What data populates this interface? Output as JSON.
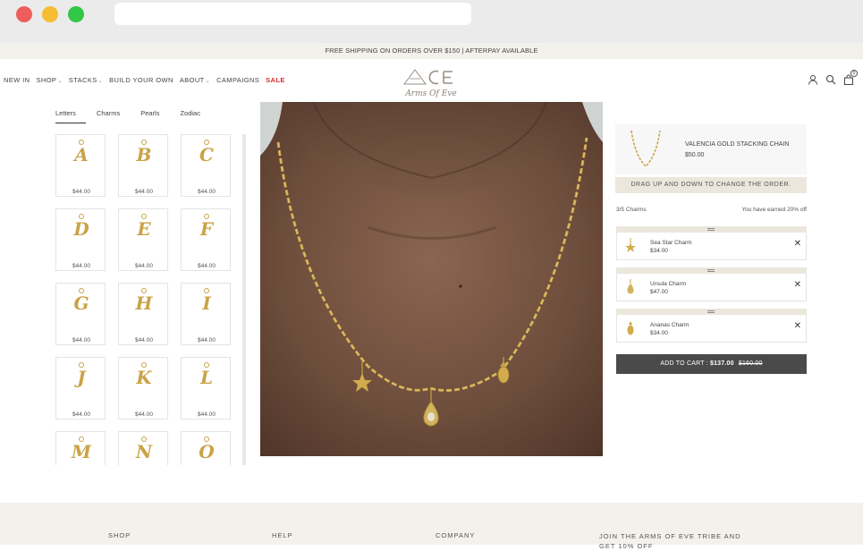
{
  "announcement": "FREE SHIPPING ON ORDERS OVER $150 | AFTERPAY AVAILABLE",
  "nav": {
    "links": [
      {
        "label": "NEW IN",
        "has_caret": false
      },
      {
        "label": "SHOP",
        "has_caret": true
      },
      {
        "label": "STACKS",
        "has_caret": true
      },
      {
        "label": "BUILD YOUR OWN",
        "has_caret": false
      },
      {
        "label": "ABOUT",
        "has_caret": true
      },
      {
        "label": "CAMPAIGNS",
        "has_caret": false
      }
    ],
    "sale_label": "SALE",
    "logo_text": "Arms Of Eve",
    "cart_count": "0"
  },
  "tabs": [
    "Letters",
    "Charms",
    "Pearls",
    "Zodiac"
  ],
  "products": [
    {
      "letter": "A",
      "price": "$44.00"
    },
    {
      "letter": "B",
      "price": "$44.00"
    },
    {
      "letter": "C",
      "price": "$44.00"
    },
    {
      "letter": "D",
      "price": "$44.00"
    },
    {
      "letter": "E",
      "price": "$44.00"
    },
    {
      "letter": "F",
      "price": "$44.00"
    },
    {
      "letter": "G",
      "price": "$44.00"
    },
    {
      "letter": "H",
      "price": "$44.00"
    },
    {
      "letter": "I",
      "price": "$44.00"
    },
    {
      "letter": "J",
      "price": "$44.00"
    },
    {
      "letter": "K",
      "price": "$44.00"
    },
    {
      "letter": "L",
      "price": "$44.00"
    },
    {
      "letter": "M",
      "price": ""
    },
    {
      "letter": "N",
      "price": ""
    },
    {
      "letter": "O",
      "price": ""
    }
  ],
  "chain": {
    "name": "VALENCIA GOLD STACKING CHAIN",
    "price": "$50.00"
  },
  "drag_hint": "DRAG UP AND DOWN TO CHANGE THE ORDER.",
  "charm_count": "3/5 Charms",
  "discount_note": "You have earned 20% off",
  "charms": [
    {
      "name": "Sea Star Charm",
      "price": "$34.00"
    },
    {
      "name": "Ursula Charm",
      "price": "$47.00"
    },
    {
      "name": "Ananas Charm",
      "price": "$34.00"
    }
  ],
  "add_to_cart": {
    "label": "ADD TO CART :",
    "price": "$137.00",
    "old_price": "$160.00"
  },
  "footer": {
    "columns": [
      "SHOP",
      "HELP",
      "COMPANY",
      "JOIN THE ARMS OF EVE TRIBE AND GET 10% OFF"
    ]
  },
  "colors": {
    "gold": "#c9a346",
    "button": "#4a4a4a",
    "sale": "#d9262f",
    "cream": "#ebe7dd"
  }
}
